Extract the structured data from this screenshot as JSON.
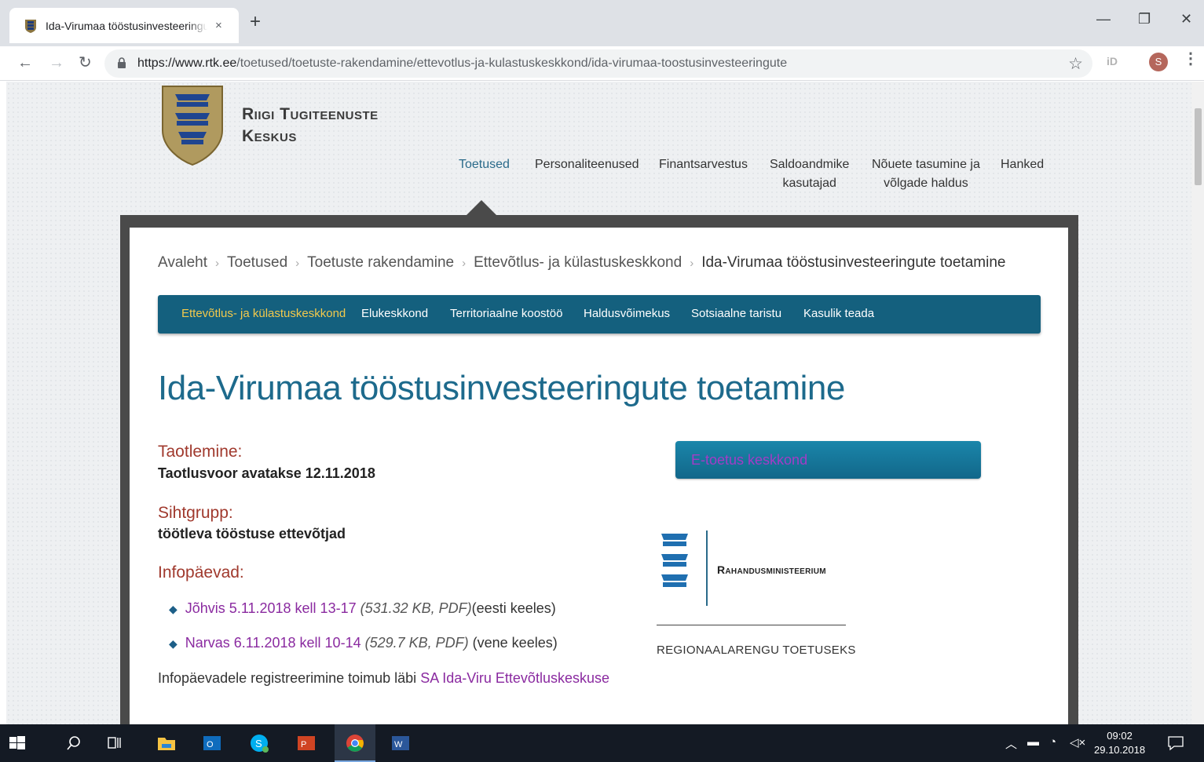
{
  "browser": {
    "tab_title": "Ida-Virumaa tööstusinvesteeringute toetamine",
    "tab_close": "×",
    "new_tab": "+",
    "url_host": "https://www.rtk.ee",
    "url_path": "/toetused/toetuste-rakendamine/ettevotlus-ja-kulastuskeskkond/ida-virumaa-toostusinvesteeringute",
    "extension_label": "iD",
    "profile_initial": "S",
    "minimize": "—",
    "restore": "❐",
    "close": "✕"
  },
  "site": {
    "brand_line1": "Riigi Tugiteenuste",
    "brand_line2": "Keskus",
    "nav": [
      {
        "label": "Toetused"
      },
      {
        "label": "Personaliteenused"
      },
      {
        "label": "Finantsarvestus"
      },
      {
        "label": "Saldoandmike",
        "label2": "kasutajad"
      },
      {
        "label": "Nõuete tasumine ja",
        "label2": "võlgade haldus"
      },
      {
        "label": "Hanked"
      }
    ]
  },
  "breadcrumb": [
    "Avaleht",
    "Toetused",
    "Toetuste rakendamine",
    "Ettevõtlus- ja külastuskeskkond",
    "Ida-Virumaa tööstusinvesteeringute toetamine"
  ],
  "breadcrumb_sep": "›",
  "subnav": [
    "Ettevõtlus- ja külastuskeskkond",
    "Elukeskkond",
    "Territoriaalne koostöö",
    "Haldusvõimekus",
    "Sotsiaalne taristu",
    "Kasulik teada"
  ],
  "main": {
    "title": "Ida-Virumaa tööstusinvesteeringute toetamine",
    "taotlemine_label": "Taotlemine:",
    "taotlemine_value": "Taotlusvoor avatakse 12.11.2018",
    "sihtgrupp_label": "Sihtgrupp:",
    "sihtgrupp_value": "töötleva tööstuse ettevõtjad",
    "infopaevad_label": "Infopäevad:",
    "infodays": [
      {
        "link": "Jõhvis 5.11.2018 kell 13-17",
        "meta": "(531.32 KB, PDF)",
        "note": "(eesti keeles)"
      },
      {
        "link": "Narvas 6.11.2018 kell 10-14",
        "meta": "(529.7 KB, PDF)",
        "note": " (vene keeles)"
      }
    ],
    "registration_text": "Infopäevadele registreerimine toimub läbi ",
    "registration_link": "SA Ida-Viru Ettevõtluskeskuse",
    "etoetus_button": "E-toetus keskkond",
    "ministry_name": "Rahandusministeerium",
    "ministry_sub": "REGIONAALARENGU TOETUSEKS"
  },
  "taskbar": {
    "time": "09:02",
    "date": "29.10.2018"
  }
}
